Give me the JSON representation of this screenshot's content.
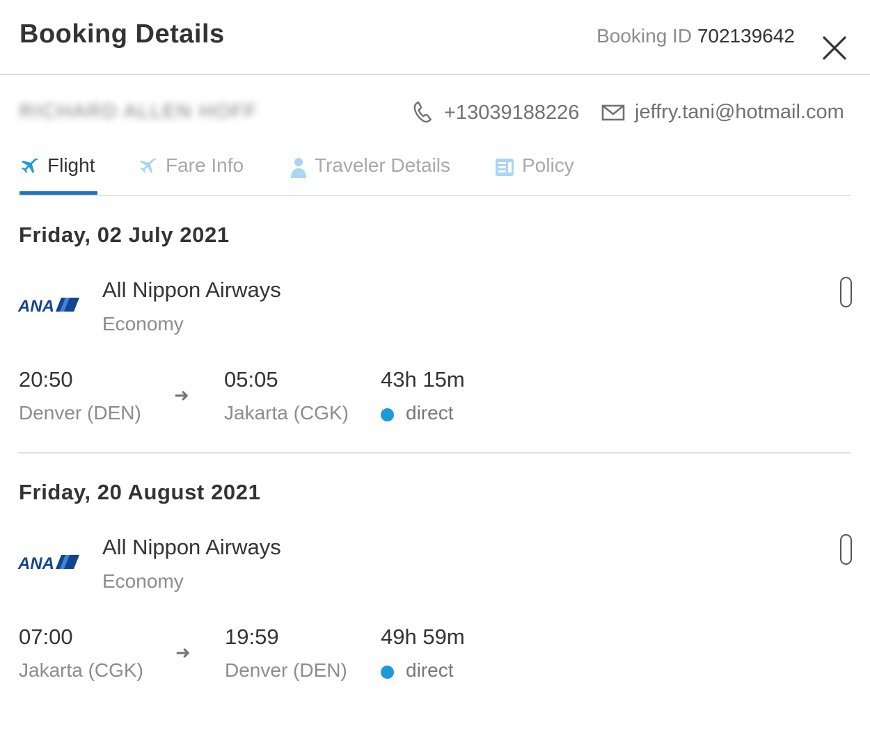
{
  "header": {
    "title": "Booking Details",
    "booking_id_label": "Booking ID",
    "booking_id": "702139642"
  },
  "traveler": {
    "name": "RICHARD ALLEN HOFF",
    "phone": "+13039188226",
    "email": "jeffry.tani@hotmail.com"
  },
  "tabs": [
    {
      "label": "Flight",
      "icon": "plane-icon",
      "active": true
    },
    {
      "label": "Fare Info",
      "icon": "plane-icon",
      "active": false
    },
    {
      "label": "Traveler Details",
      "icon": "person-icon",
      "active": false
    },
    {
      "label": "Policy",
      "icon": "document-icon",
      "active": false
    }
  ],
  "legs": [
    {
      "date": "Friday, 02 July 2021",
      "airline": "All Nippon Airways",
      "airline_logo_text": "ANA",
      "cabin": "Economy",
      "depart_time": "20:50",
      "depart_place": "Denver (DEN)",
      "arrive_time": "05:05",
      "arrive_place": "Jakarta (CGK)",
      "duration": "43h 15m",
      "stops": "direct"
    },
    {
      "date": "Friday, 20 August 2021",
      "airline": "All Nippon Airways",
      "airline_logo_text": "ANA",
      "cabin": "Economy",
      "depart_time": "07:00",
      "depart_place": "Jakarta (CGK)",
      "arrive_time": "19:59",
      "arrive_place": "Denver (DEN)",
      "duration": "49h 59m",
      "stops": "direct"
    }
  ],
  "colors": {
    "accent": "#1f72c4",
    "direct_dot": "#1f9ad8",
    "inactive_icon": "#a8d6f3"
  }
}
